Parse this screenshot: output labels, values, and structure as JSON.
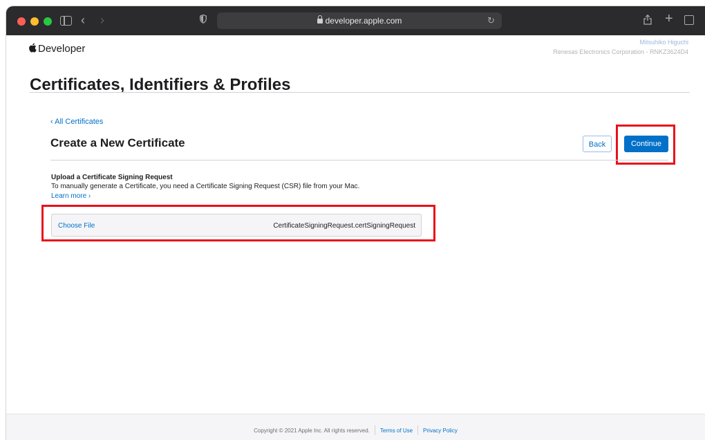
{
  "browser": {
    "url": "developer.apple.com"
  },
  "header": {
    "brand": "Developer",
    "account_name": "Mitsuhiko Higuchi",
    "account_org": "Renesas Electronics Corporation - RNKZ3624D4"
  },
  "page": {
    "title": "Certificates, Identifiers & Profiles",
    "back_link": "‹ All Certificates",
    "section_title": "Create a New Certificate",
    "back_button": "Back",
    "continue_button": "Continue"
  },
  "upload": {
    "heading": "Upload a Certificate Signing Request",
    "description": "To manually generate a Certificate, you need a Certificate Signing Request (CSR) file from your Mac.",
    "learn_more": "Learn more ›",
    "choose_file": "Choose File",
    "file_name": "CertificateSigningRequest.certSigningRequest"
  },
  "footer": {
    "copyright": "Copyright © 2021 Apple Inc. All rights reserved.",
    "terms": "Terms of Use",
    "privacy": "Privacy Policy"
  },
  "colors": {
    "accent": "#0070c9",
    "highlight": "#e8101a",
    "titlebar": "#2b2b2d"
  },
  "icons": [
    "sidebar-icon",
    "back-icon",
    "forward-icon",
    "shield-icon",
    "lock-icon",
    "reload-icon",
    "share-icon",
    "new-tab-icon",
    "tabs-icon",
    "apple-logo-icon"
  ]
}
